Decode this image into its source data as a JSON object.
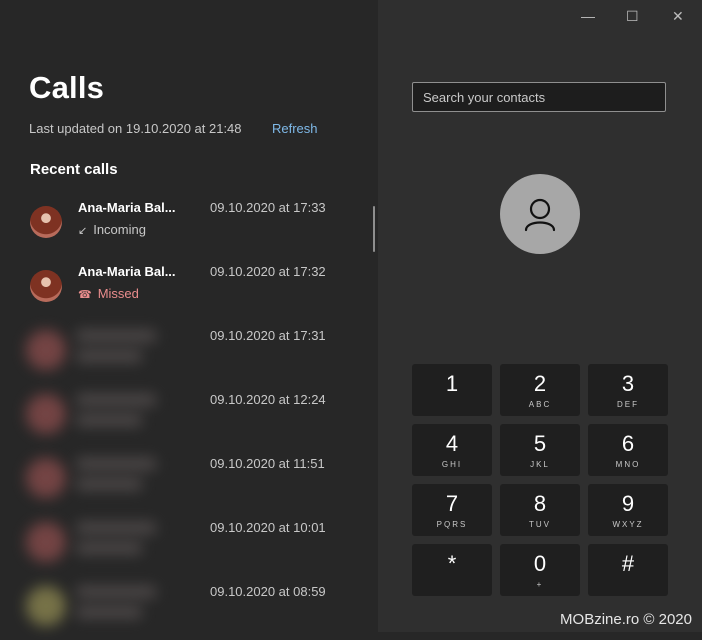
{
  "window_controls": {
    "minimize": "—",
    "maximize": "☐",
    "close": "✕"
  },
  "header": {
    "title": "Calls",
    "last_updated": "Last updated on 19.10.2020 at 21:48",
    "refresh_label": "Refresh"
  },
  "recent": {
    "title": "Recent calls",
    "calls": [
      {
        "name": "Ana-Maria Bal...",
        "type": "Incoming",
        "time": "09.10.2020 at 17:33"
      },
      {
        "name": "Ana-Maria Bal...",
        "type": "Missed",
        "time": "09.10.2020 at 17:32"
      },
      {
        "name": "",
        "type": "",
        "time": "09.10.2020 at 17:31"
      },
      {
        "name": "",
        "type": "",
        "time": "09.10.2020 at 12:24"
      },
      {
        "name": "",
        "type": "",
        "time": "09.10.2020 at 11:51"
      },
      {
        "name": "",
        "type": "",
        "time": "09.10.2020 at 10:01"
      },
      {
        "name": "",
        "type": "",
        "time": "09.10.2020 at 08:59"
      }
    ]
  },
  "search": {
    "placeholder": "Search your contacts"
  },
  "dialpad": [
    {
      "digit": "1",
      "letters": ""
    },
    {
      "digit": "2",
      "letters": "ABC"
    },
    {
      "digit": "3",
      "letters": "DEF"
    },
    {
      "digit": "4",
      "letters": "GHI"
    },
    {
      "digit": "5",
      "letters": "JKL"
    },
    {
      "digit": "6",
      "letters": "MNO"
    },
    {
      "digit": "7",
      "letters": "PQRS"
    },
    {
      "digit": "8",
      "letters": "TUV"
    },
    {
      "digit": "9",
      "letters": "WXYZ"
    },
    {
      "digit": "*",
      "letters": ""
    },
    {
      "digit": "0",
      "letters": "+"
    },
    {
      "digit": "#",
      "letters": ""
    }
  ],
  "watermark": "MOBzine.ro © 2020",
  "colors": {
    "link": "#7fb9e8",
    "missed": "#ea8d8d",
    "key_bg": "#1f1f1f",
    "left_bg": "#272727",
    "right_bg": "#2f2f2f"
  },
  "icons": {
    "incoming": "incoming-call-icon",
    "missed": "missed-call-icon",
    "contact": "person-icon"
  }
}
